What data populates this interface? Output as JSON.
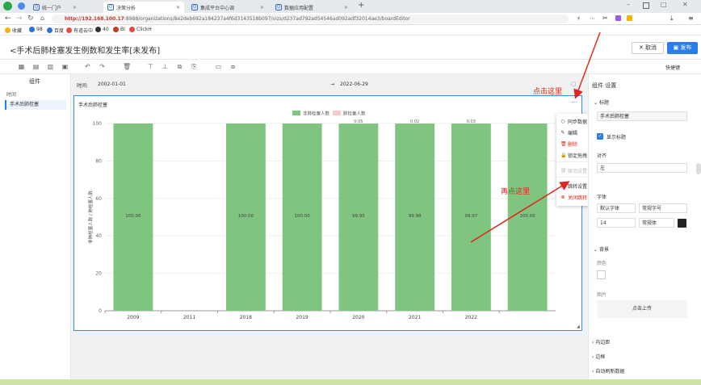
{
  "browser": {
    "tabs": [
      {
        "label": "统一门户"
      },
      {
        "label": "决策分析"
      },
      {
        "label": "集成平台中心调"
      },
      {
        "label": "数据应用配置"
      }
    ],
    "url_host": "http://192.168.100.17",
    "url_rest": ":8988/organizations/8e2deb692a184237a4f6d3143518b097/vizs/d237ad792ad54546ad092adf32014ae3/boardEditor",
    "bookmarks": [
      "收藏",
      "98",
      "百度",
      "有道云中",
      "40",
      "BI",
      "ClickH"
    ]
  },
  "header": {
    "title": "<手术后肺栓塞发生例数和发生率[未发布]",
    "cancel_label": "取消",
    "publish_label": "发布",
    "shortcut_label": "快捷键"
  },
  "left_panel": {
    "heading": "组件",
    "section": "时间",
    "item": "手术后肺栓塞"
  },
  "filter": {
    "label": "时间:",
    "start": "2002-01-01",
    "arrow": "→",
    "end": "2022-06-29"
  },
  "chart_widget": {
    "title": "手术后肺栓塞",
    "more": "..."
  },
  "context_menu": {
    "items": [
      "同步数据",
      "编辑",
      "删除",
      "锁定拖拽",
      "联动设置",
      "跳转设置",
      "关闭跳转"
    ]
  },
  "annotations": {
    "first": "点击这里",
    "second": "再点这里"
  },
  "right_panel": {
    "heading": "组件 设置",
    "title_section": "标题",
    "title_value": "手术后肺栓塞",
    "show_title": "显示标题",
    "align_label": "对齐",
    "align_value": "左",
    "font_label": "字体",
    "font_family": "默认字体",
    "font_weight_style": "常规字号",
    "font_size": "14",
    "font_style": "常规体",
    "bg_section": "背景",
    "color_label": "颜色",
    "image_label": "图片",
    "upload_label": "点击上传",
    "padding_section": "内边距",
    "border_section": "边框",
    "refresh_section": "自动刷新数据"
  },
  "chart_data": {
    "type": "bar",
    "categories": [
      "2009",
      "2011",
      "2018",
      "2019",
      "2020",
      "2021",
      "2022"
    ],
    "series": [
      {
        "name": "非肺栓塞人数",
        "values": [
          100,
          0,
          100,
          100,
          99.95,
          99.98,
          99.97
        ],
        "color": "#7fc47f"
      },
      {
        "name": "肺栓塞人数",
        "values": [
          0,
          0,
          0,
          0,
          0.05,
          0.02,
          0.03
        ],
        "color": "#f7c9c9"
      }
    ],
    "bar_labels": [
      "100.00",
      "",
      "100.00",
      "100.00",
      "99.95",
      "99.98",
      "99.97",
      "100.00"
    ],
    "top_labels": [
      "",
      "",
      "",
      "",
      "0.05",
      "0.02",
      "0.03",
      ""
    ],
    "extra_bar": {
      "value": 100,
      "label": "100.00"
    },
    "yticks": [
      0,
      20,
      40,
      60,
      80,
      100
    ],
    "ylabel": "非肺栓塞人数 / 肺栓塞人数",
    "ylim": [
      0,
      100
    ],
    "legend": "top-center",
    "grid": true
  }
}
